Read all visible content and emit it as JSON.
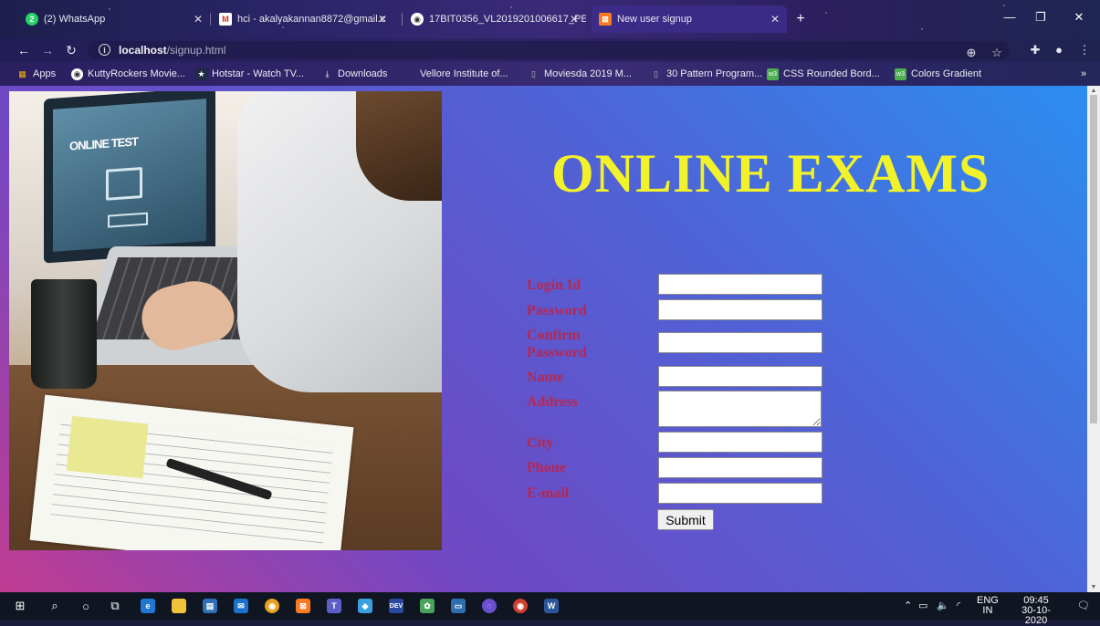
{
  "browser": {
    "tabs": [
      {
        "title": "(2) WhatsApp",
        "icon": "whatsapp-icon",
        "badge": "2",
        "active": false
      },
      {
        "title": "hci - akalyakannan8872@gmail.c",
        "icon": "gmail-icon",
        "active": false
      },
      {
        "title": "17BIT0356_VL2019201006617_PE",
        "icon": "globe-icon",
        "active": false
      },
      {
        "title": "New user signup",
        "icon": "xampp-icon",
        "active": true
      }
    ],
    "new_tab_label": "+",
    "url_host": "localhost",
    "url_path": "/signup.html",
    "bookmarks": [
      {
        "label": "Apps",
        "icon": "apps-grid-icon"
      },
      {
        "label": "KuttyRockers Movie...",
        "icon": "globe-icon"
      },
      {
        "label": "Hotstar - Watch TV...",
        "icon": "hotstar-icon"
      },
      {
        "label": "Downloads",
        "icon": "download-icon"
      },
      {
        "label": "Vellore Institute of...",
        "icon": "vit-icon"
      },
      {
        "label": "Moviesda 2019 M...",
        "icon": "page-icon"
      },
      {
        "label": "30 Pattern Program...",
        "icon": "page-icon"
      },
      {
        "label": "CSS Rounded Bord...",
        "icon": "w3-icon"
      },
      {
        "label": "Colors Gradient",
        "icon": "w3-icon"
      }
    ],
    "bookmarks_overflow": "»"
  },
  "page": {
    "heading": "ONLINE EXAMS",
    "photo_text": "ONLINE TEST",
    "form": {
      "fields": [
        {
          "label": "Login Id",
          "value": ""
        },
        {
          "label": "Password",
          "value": ""
        },
        {
          "label": "Confirm Password",
          "value": ""
        },
        {
          "label": "Name",
          "value": ""
        },
        {
          "label": "Address",
          "value": ""
        },
        {
          "label": "City",
          "value": ""
        },
        {
          "label": "Phone",
          "value": ""
        },
        {
          "label": "E-mail",
          "value": ""
        }
      ],
      "submit_label": "Submit"
    }
  },
  "taskbar": {
    "language": "ENG",
    "region": "IN",
    "time": "09:45",
    "date": "30-10-2020"
  }
}
